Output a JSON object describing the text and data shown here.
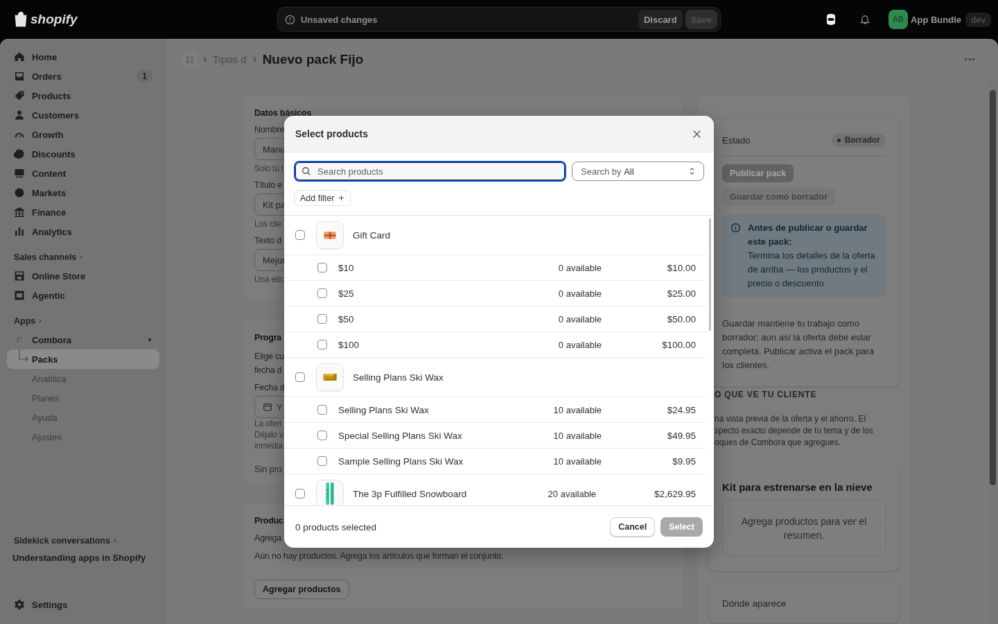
{
  "topbar": {
    "logo": "shopify",
    "unsaved": {
      "message": "Unsaved changes",
      "discard": "Discard",
      "save": "Save"
    },
    "user": {
      "initials": "AB",
      "name": "App Bundle",
      "badge": "dev"
    }
  },
  "sidebar": {
    "items": [
      {
        "label": "Home",
        "selected": false
      },
      {
        "label": "Orders",
        "badge": "1",
        "selected": false
      },
      {
        "label": "Products",
        "selected": false
      },
      {
        "label": "Customers",
        "selected": false
      },
      {
        "label": "Growth",
        "selected": false
      },
      {
        "label": "Discounts",
        "selected": false
      },
      {
        "label": "Content",
        "selected": false
      },
      {
        "label": "Markets",
        "selected": false
      },
      {
        "label": "Finance",
        "selected": false
      },
      {
        "label": "Analytics",
        "selected": false
      }
    ],
    "sales_channels": {
      "heading": "Sales channels",
      "items": [
        {
          "label": "Online Store"
        },
        {
          "label": "Agentic"
        }
      ]
    },
    "apps": {
      "heading": "Apps",
      "app": {
        "label": "Combora",
        "children": [
          {
            "label": "Packs",
            "selected": true
          },
          {
            "label": "Analítica",
            "selected": false
          },
          {
            "label": "Planes",
            "selected": false
          },
          {
            "label": "Ayuda",
            "selected": false
          },
          {
            "label": "Ajustes",
            "selected": false
          }
        ]
      }
    },
    "sidekick": {
      "heading": "Sidekick conversations",
      "items": [
        "Understanding apps in Shopify"
      ]
    },
    "settings": "Settings"
  },
  "page": {
    "breadcrumb": "Tipos d",
    "title": "Nuevo pack Fijo"
  },
  "left_cards": [
    {
      "heading": "Datos básicos",
      "fields": [
        {
          "label": "Nombre",
          "value": "Manu",
          "help": "Solo tú l"
        },
        {
          "label": "Título e",
          "value": "Kit pa",
          "help": "Los clie"
        },
        {
          "label": "Texto d",
          "value": "Mejor",
          "help": "Una etic"
        }
      ]
    },
    {
      "heading": "Progra",
      "lines": [
        "Elige cu",
        "fecha d"
      ],
      "fields": [
        {
          "label": "Fecha d",
          "value": "Y",
          "kind": "date",
          "help_lines": [
            "La ofert",
            "Déjalo v",
            "inmedia"
          ]
        }
      ],
      "footer": "Sin pro"
    },
    {
      "heading": "Produc",
      "paragraphs": [
        "Agrega",
        "Aún no hay productos. Agrega los artículos que forman el conjunto."
      ],
      "button": "Agregar productos"
    }
  ],
  "status_card": {
    "label": "Estado",
    "badge": "Borrador",
    "buttons": [
      {
        "label": "Publicar pack",
        "kind": "primary",
        "disabled": true
      },
      {
        "label": "Guardar como borrador",
        "kind": "secondary",
        "disabled": true
      }
    ],
    "banner": {
      "title": "Antes de publicar o guardar este pack:",
      "text": "Termina los detalles de la oferta de arriba — los productos y el precio o descuento"
    },
    "note": "Guardar mantiene tu trabajo como borrador; aun así la oferta debe estar completa. Publicar activa el pack para los clientes."
  },
  "preview": {
    "heading": "O QUE VE TU CLIENTE",
    "lines": [
      "na vista previa de la oferta y el ahorro. El",
      "specto exacto depende de tu tema y de los",
      "oques de Combora que agregues."
    ]
  },
  "summary_card": {
    "title": "Kit para estrenarse en la nieve",
    "empty": "Agrega productos para ver el resumen."
  },
  "placement_card": {
    "title": "Dónde aparece"
  },
  "modal": {
    "title": "Select products",
    "search_placeholder": "Search products",
    "search_by": {
      "label": "Search by",
      "value": "All"
    },
    "add_filter": "Add filter",
    "products": [
      {
        "title": "Gift Card",
        "checked": false,
        "variants": [
          {
            "title": "$10",
            "available": "0 available",
            "price": "$10.00",
            "checked": false
          },
          {
            "title": "$25",
            "available": "0 available",
            "price": "$25.00",
            "checked": false
          },
          {
            "title": "$50",
            "available": "0 available",
            "price": "$50.00",
            "checked": false
          },
          {
            "title": "$100",
            "available": "0 available",
            "price": "$100.00",
            "checked": false
          }
        ]
      },
      {
        "title": "Selling Plans Ski Wax",
        "checked": false,
        "variants": [
          {
            "title": "Selling Plans Ski Wax",
            "available": "10 available",
            "price": "$24.95",
            "checked": false
          },
          {
            "title": "Special Selling Plans Ski Wax",
            "available": "10 available",
            "price": "$49.95",
            "checked": false
          },
          {
            "title": "Sample Selling Plans Ski Wax",
            "available": "10 available",
            "price": "$9.95",
            "checked": false
          }
        ]
      },
      {
        "title": "The 3p Fulfilled Snowboard",
        "checked": false,
        "available": "20 available",
        "price": "$2,629.95"
      }
    ],
    "selected_count": "0 products selected",
    "cancel": "Cancel",
    "select": {
      "label": "Select",
      "disabled": true
    }
  }
}
